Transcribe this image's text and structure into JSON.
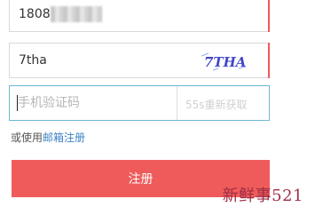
{
  "form": {
    "phone_value": "1808",
    "captcha_value": "7tha",
    "captcha_image_text": "7THA",
    "sms_placeholder": "手机验证码",
    "sms_button_label": "55s重新获取"
  },
  "alternate_signup": {
    "prefix": "或使用",
    "link_text": "邮箱注册"
  },
  "actions": {
    "register_label": "注册"
  },
  "watermark": {
    "text": "新鲜事521"
  },
  "colors": {
    "brand_red": "#ef5b5b",
    "link_blue": "#3b82c4",
    "focus_blue": "#6db8d6",
    "captcha_blue": "#3f46c7"
  }
}
